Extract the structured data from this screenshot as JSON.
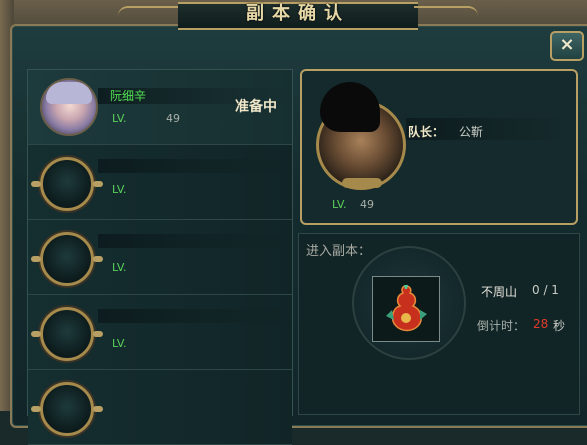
{
  "window": {
    "title": "副本确认",
    "close_label": "×"
  },
  "members": [
    {
      "name": "阮细辛",
      "lv_label": "LV.",
      "level": "49",
      "status": "准备中",
      "filled": true
    },
    {
      "name": "",
      "lv_label": "LV.",
      "level": "",
      "status": "",
      "filled": false
    },
    {
      "name": "",
      "lv_label": "LV.",
      "level": "",
      "status": "",
      "filled": false
    },
    {
      "name": "",
      "lv_label": "LV.",
      "level": "",
      "status": "",
      "filled": false
    }
  ],
  "leader": {
    "captain_label": "队长：",
    "captain_name": "公靳",
    "lv_label": "LV.",
    "level": "49"
  },
  "dungeon": {
    "enter_label": "进入副本：",
    "name": "不周山",
    "count": "0 / 1",
    "timer_label": "倒计时：",
    "timer_value": "28",
    "timer_unit": "秒"
  },
  "colors": {
    "accent_gold": "#b8a064",
    "level_green": "#52e052",
    "timer_red": "#e03a2a"
  }
}
